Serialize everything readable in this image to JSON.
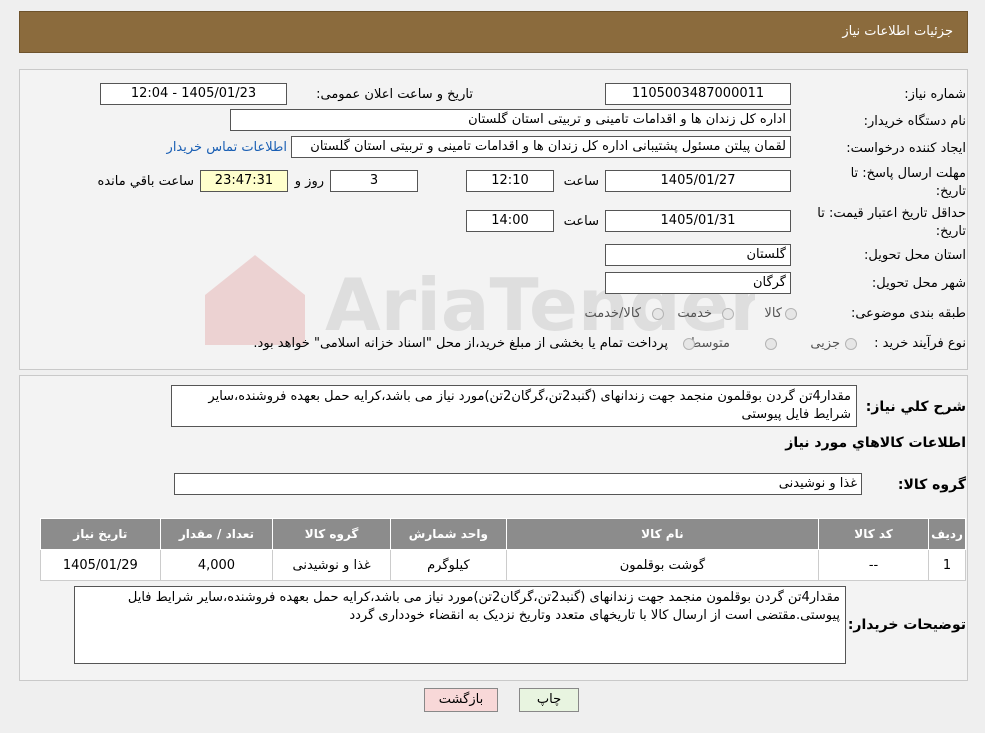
{
  "header": {
    "title": "جزئیات اطلاعات نیاز"
  },
  "form": {
    "need_number": {
      "label": "شماره نیاز:",
      "value": "1105003487000011"
    },
    "announce_datetime": {
      "label": "تاریخ و ساعت اعلان عمومی:",
      "value": "1405/01/23 - 12:04"
    },
    "buyer_org": {
      "label": "نام دستگاه خریدار:",
      "value": "اداره کل زندان ها و اقدامات تامینی و تربیتی استان گلستان"
    },
    "requester": {
      "label": "ایجاد کننده درخواست:",
      "value": "لقمان پیلتن مسئول پشتیبانی اداره کل زندان ها و اقدامات تامینی و تربیتی استان گلستان",
      "link": "اطلاعات تماس خریدار"
    },
    "deadline": {
      "label": "مهلت ارسال پاسخ: تا تاریخ:",
      "date": "1405/01/27",
      "time_label": "ساعت",
      "time": "12:10",
      "days": "3",
      "days_label": "روز و",
      "remaining": "23:47:31",
      "remaining_label": "ساعت باقي مانده"
    },
    "price_validity": {
      "label": "حداقل تاریخ اعتبار قیمت: تا تاریخ:",
      "date": "1405/01/31",
      "time_label": "ساعت",
      "time": "14:00"
    },
    "delivery_province": {
      "label": "استان محل تحویل:",
      "value": "گلستان"
    },
    "delivery_city": {
      "label": "شهر محل تحویل:",
      "value": "گرگان"
    },
    "category": {
      "label": "طبقه بندی موضوعی:",
      "options": [
        "کالا",
        "خدمت",
        "کالا/خدمت"
      ]
    },
    "purchase_type": {
      "label": "نوع فرآیند خرید :",
      "options": [
        "جزیی",
        "متوسط"
      ],
      "note": "پرداخت تمام یا بخشی از مبلغ خرید،از محل \"اسناد خزانه اسلامی\" خواهد بود."
    }
  },
  "description": {
    "label": "شرح کلي نياز:",
    "value": "مقدار4تن گردن بوقلمون منجمد جهت زندانهای (گنبد2تن،گرگان2تن)مورد نیاز می باشد،کرایه حمل بعهده فروشنده،سایر شرایط فایل پیوستی"
  },
  "goods_section": {
    "title": "اطلاعات کالاهاي مورد نياز"
  },
  "goods_group": {
    "label": "گروه کالا:",
    "value": "غذا و نوشیدنی"
  },
  "table": {
    "headers": [
      "رديف",
      "کد کالا",
      "نام کالا",
      "واحد شمارش",
      "گروه کالا",
      "تعداد / مقدار",
      "تاریخ نیاز"
    ],
    "rows": [
      [
        "1",
        "--",
        "گوشت بوقلمون",
        "کیلوگرم",
        "غذا و نوشیدنی",
        "4,000",
        "1405/01/29"
      ]
    ]
  },
  "buyer_notes": {
    "label": "توضیحات خریدار:",
    "value": "مقدار4تن گردن بوقلمون منجمد جهت زندانهای (گنبد2تن،گرگان2تن)مورد نیاز می باشد،کرایه حمل بعهده فروشنده،سایر شرایط فایل پیوستی.مقتضی است از ارسال کالا با تاریخهای متعدد وتاریخ نزدیک به انقضاء خودداری گردد"
  },
  "buttons": {
    "print": "چاپ",
    "back": "بازگشت"
  },
  "watermark": {
    "text": "AriaTender.neT"
  },
  "colors": {
    "header_bg": "#8b6b3d",
    "link": "#1a5fb4",
    "table_header": "#8c8c8c",
    "back_button": "#f8d8d8",
    "print_button": "#e8f4e0"
  }
}
